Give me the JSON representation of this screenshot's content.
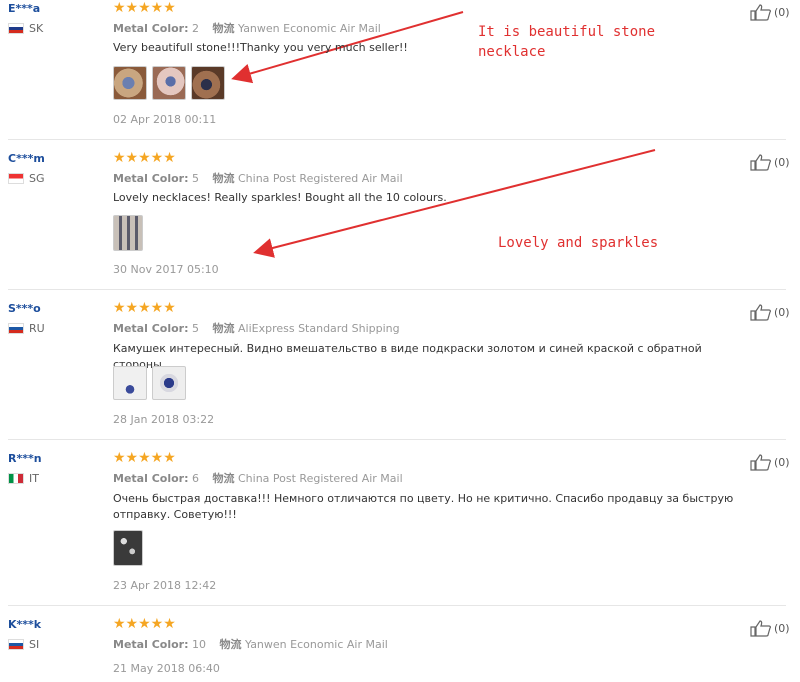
{
  "labels": {
    "metal_color": "Metal Color:",
    "shipping": "物流"
  },
  "colors": {
    "accent_red": "#e03030",
    "star": "#f5a623",
    "user_link": "#1d4e9c"
  },
  "reviews": [
    {
      "user": "E***a",
      "country": "SK",
      "stars": "★★★★★",
      "metal_color": "2",
      "shipping": "Yanwen Economic Air Mail",
      "text": "Very beautifull stone!!!Thanky you very much seller!!",
      "date": "02 Apr 2018 00:11",
      "helpful": "(0)"
    },
    {
      "user": "C***m",
      "country": "SG",
      "stars": "★★★★★",
      "metal_color": "5",
      "shipping": "China Post Registered Air Mail",
      "text": "Lovely necklaces! Really sparkles! Bought all the 10 colours.",
      "date": "30 Nov 2017 05:10",
      "helpful": "(0)"
    },
    {
      "user": "S***o",
      "country": "RU",
      "stars": "★★★★★",
      "metal_color": "5",
      "shipping": "AliExpress Standard Shipping",
      "text": "Камушек интересный. Видно вмешательство в виде подкраски золотом и синей краской с обратной стороны.",
      "date": "28 Jan 2018 03:22",
      "helpful": "(0)"
    },
    {
      "user": "R***n",
      "country": "IT",
      "stars": "★★★★★",
      "metal_color": "6",
      "shipping": "China Post Registered Air Mail",
      "text": "Очень быстрая доставка!!! Немного отличаются по цвету. Но не критично. Спасибо продавцу за быструю отправку. Советую!!!",
      "date": "23 Apr 2018 12:42",
      "helpful": "(0)"
    },
    {
      "user": "K***k",
      "country": "SI",
      "stars": "★★★★★",
      "metal_color": "10",
      "shipping": "Yanwen Economic Air Mail",
      "text": "",
      "date": "21 May 2018 06:40",
      "helpful": "(0)"
    }
  ],
  "annotations": {
    "first": "It is beautiful stone\nnecklace",
    "second": "Lovely and sparkles"
  }
}
